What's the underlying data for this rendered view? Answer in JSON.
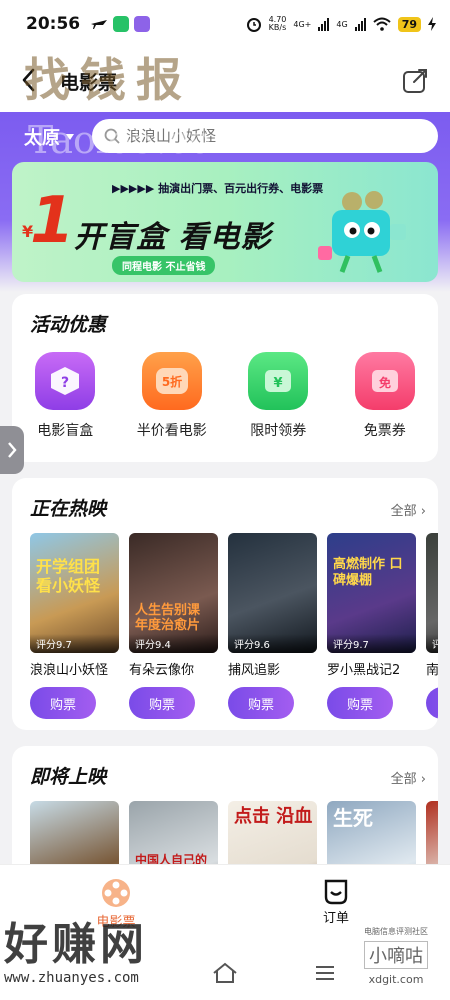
{
  "status": {
    "time": "20:56",
    "net_speed": "4.70",
    "net_unit": "KB/s",
    "sig1": "4G+",
    "sig2": "4G",
    "battery": "79"
  },
  "header": {
    "title": "电影票"
  },
  "location": {
    "city": "太原"
  },
  "search": {
    "placeholder": "浪浪山小妖怪"
  },
  "banner": {
    "top_text": "▶▶▶▶▶ 抽演出门票、百元出行券、电影票",
    "yen": "¥",
    "big_number": "1",
    "headline": "开盲盒 看电影",
    "pill": "同程电影  不止省钱"
  },
  "activities": {
    "title": "活动优惠",
    "items": [
      {
        "label": "电影盲盒",
        "glyph": "?",
        "color_top": "#c86bf6",
        "color_bottom": "#8f3ee6"
      },
      {
        "label": "半价看电影",
        "glyph": "5折",
        "color_top": "#ffa14a",
        "color_bottom": "#ff6a1f"
      },
      {
        "label": "限时领券",
        "glyph": "¥",
        "color_top": "#5be884",
        "color_bottom": "#22c25a"
      },
      {
        "label": "免票券",
        "glyph": "免",
        "color_top": "#ff7aa2",
        "color_bottom": "#f43d6b"
      }
    ]
  },
  "now_showing": {
    "title": "正在热映",
    "more": "全部 ›",
    "buy_label": "购票",
    "movies": [
      {
        "name": "浪浪山小妖怪",
        "score": "评分9.7",
        "poster_text": "开学组团\n看小妖怪",
        "text_color": "#ffe14a",
        "bg": "linear-gradient(160deg,#8fc7e6,#c89a55 60%,#6b4a2a)"
      },
      {
        "name": "有朵云像你",
        "score": "评分9.4",
        "poster_text": "人生告别课\n年度治愈片",
        "text_color": "#ff9a3c",
        "bg": "linear-gradient(160deg,#3a2a26,#7a5a50 60%,#2b1c1a)"
      },
      {
        "name": "捕风追影",
        "score": "评分9.6",
        "poster_text": "",
        "text_color": "#fff",
        "bg": "linear-gradient(160deg,#24313e,#4b5560 55%,#12181f)"
      },
      {
        "name": "罗小黑战记2",
        "score": "评分9.7",
        "poster_text": "高燃制作 口碑爆棚",
        "text_color": "#ffd84a",
        "bg": "linear-gradient(160deg,#2d3e8a,#5a3a8a 60%,#1c1f4a)"
      },
      {
        "name": "南",
        "score": "评分",
        "poster_text": "",
        "text_color": "#fff",
        "bg": "linear-gradient(160deg,#3a3f3a,#666 60%,#222)"
      }
    ]
  },
  "coming_soon": {
    "title": "即将上映",
    "more": "全部 ›",
    "movies": [
      {
        "poster_text": "",
        "bg": "linear-gradient(160deg,#c7dbe6,#7a5a3a 60%,#c8a070)"
      },
      {
        "poster_text": "中国人自己的",
        "bg": "linear-gradient(160deg,#9aa4aa,#d8dde0 60%,#5a5050)"
      },
      {
        "poster_text": "点击 沿血",
        "bg": "linear-gradient(160deg,#f4efe6,#e5ddd0 60%,#5a3a30)"
      },
      {
        "poster_text": "生死",
        "bg": "linear-gradient(160deg,#8fa8c0,#dfe8ef 60%,#7a8fa0)"
      },
      {
        "poster_text": "",
        "bg": "linear-gradient(160deg,#b03020,#e8e0d8 60%,#402020)"
      }
    ]
  },
  "bottom_nav": {
    "movie_label": "电影票",
    "orders_label": "订单"
  },
  "watermarks": {
    "top": "找钱报",
    "mid": "Taolo5.com",
    "bottom_left": "好赚网",
    "bottom_left_url": "www.zhuanyes.com",
    "bottom_right": "小嘀咕",
    "bottom_right_small": "电脑信息评测社区",
    "bottom_right_url": "xdgit.com"
  },
  "colors": {
    "accent": "#7c5cf0",
    "buy": "#8f52ec"
  }
}
